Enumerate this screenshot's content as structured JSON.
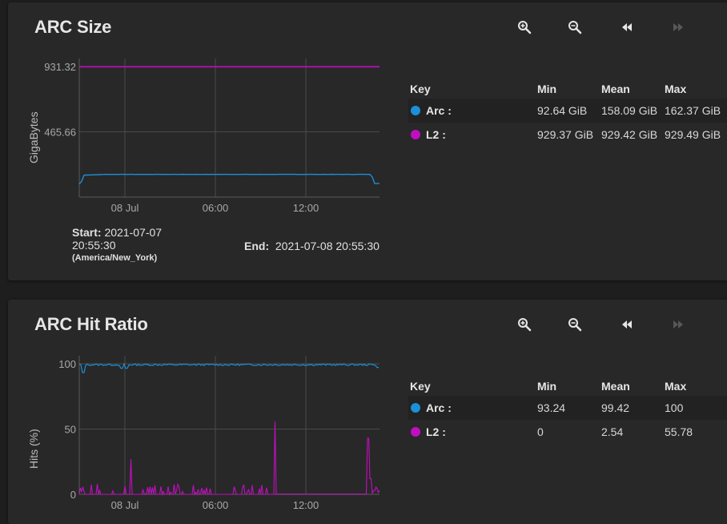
{
  "colors": {
    "arc": "#1b8fd8",
    "l2": "#c10ec1",
    "grid": "#4a4a4a",
    "axis": "#9e9e9e"
  },
  "toolbar_icons": [
    "zoom-in-icon",
    "zoom-out-icon",
    "rewind-icon",
    "fast-forward-icon"
  ],
  "arc_size": {
    "title": "ARC Size",
    "ylabel": "GigaBytes",
    "legend": {
      "headers": {
        "key": "Key",
        "min": "Min",
        "mean": "Mean",
        "max": "Max"
      },
      "rows": [
        {
          "name": "Arc :",
          "min": "92.64 GiB",
          "mean": "158.09 GiB",
          "max": "162.37 GiB"
        },
        {
          "name": "L2 :",
          "min": "929.37 GiB",
          "mean": "929.42 GiB",
          "max": "929.49 GiB"
        }
      ]
    },
    "range": {
      "start_label": "Start:",
      "start_date": "2021-07-07",
      "start_time": "20:55:30",
      "timezone": "(America/New_York)",
      "end_label": "End:",
      "end_value": "2021-07-08 20:55:30"
    }
  },
  "arc_hit": {
    "title": "ARC Hit Ratio",
    "ylabel": "Hits (%)",
    "legend": {
      "headers": {
        "key": "Key",
        "min": "Min",
        "mean": "Mean",
        "max": "Max"
      },
      "rows": [
        {
          "name": "Arc :",
          "min": "93.24",
          "mean": "99.42",
          "max": "100"
        },
        {
          "name": "L2 :",
          "min": "0",
          "mean": "2.54",
          "max": "55.78"
        }
      ]
    }
  },
  "chart_data": [
    {
      "type": "line",
      "ylabel": "GigaBytes",
      "yticks": [
        "931.32",
        "465.66"
      ],
      "xticks": [
        "08 Jul",
        "06:00",
        "12:00"
      ],
      "ylim": [
        0,
        931.32
      ],
      "series": [
        {
          "name": "Arc",
          "unit": "GiB",
          "min": 92.64,
          "mean": 158.09,
          "max": 162.37
        },
        {
          "name": "L2",
          "unit": "GiB",
          "min": 929.37,
          "mean": 929.42,
          "max": 929.49
        }
      ]
    },
    {
      "type": "line",
      "ylabel": "Hits (%)",
      "yticks": [
        "100",
        "50",
        "0"
      ],
      "xticks": [
        "08 Jul",
        "06:00",
        "12:00"
      ],
      "ylim": [
        0,
        100
      ],
      "series": [
        {
          "name": "Arc",
          "min": 93.24,
          "mean": 99.42,
          "max": 100
        },
        {
          "name": "L2",
          "min": 0,
          "mean": 2.54,
          "max": 55.78
        }
      ]
    }
  ]
}
